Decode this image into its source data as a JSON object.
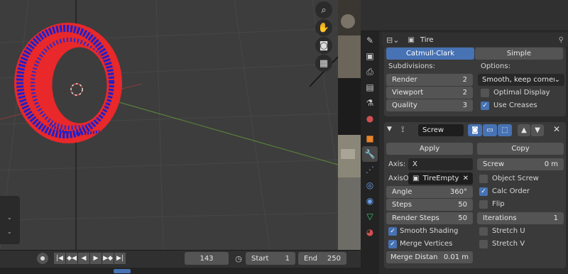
{
  "viewport": {
    "nav_icons": [
      "zoom-icon",
      "hand-pan-icon",
      "camera-icon",
      "grid-icon"
    ]
  },
  "timeline": {
    "current_frame": "143",
    "start_label": "Start",
    "start_value": "1",
    "end_label": "End",
    "end_value": "250"
  },
  "props": {
    "object_name": "Tire",
    "subsurf": {
      "tab_catmull": "Catmull-Clark",
      "tab_simple": "Simple",
      "subdivisions_label": "Subdivisions:",
      "options_label": "Options:",
      "render_label": "Render",
      "render_value": "2",
      "viewport_label": "Viewport",
      "viewport_value": "2",
      "quality_label": "Quality",
      "quality_value": "3",
      "uv_option": "Smooth, keep corners",
      "optimal_display": "Optimal Display",
      "use_creases": "Use Creases"
    },
    "screw": {
      "name": "Screw",
      "apply": "Apply",
      "copy": "Copy",
      "axis_label": "Axis:",
      "axis_value": "X",
      "axis_object_label": "AxisO",
      "axis_object_value": "TireEmpty",
      "screw_label": "Screw",
      "screw_value": "0 m",
      "object_screw": "Object Screw",
      "angle_label": "Angle",
      "angle_value": "360°",
      "calc_order": "Calc Order",
      "steps_label": "Steps",
      "steps_value": "50",
      "flip": "Flip",
      "render_steps_label": "Render Steps",
      "render_steps_value": "50",
      "iterations_label": "Iterations",
      "iterations_value": "1",
      "smooth_shading": "Smooth Shading",
      "stretch_u": "Stretch U",
      "merge_vertices": "Merge Vertices",
      "stretch_v": "Stretch V",
      "merge_distance_label": "Merge Distan",
      "merge_distance_value": "0.01 m"
    }
  },
  "colors": {
    "accent": "#4772b3",
    "tire_red": "#e8282a",
    "tire_blue": "#2020c8"
  }
}
